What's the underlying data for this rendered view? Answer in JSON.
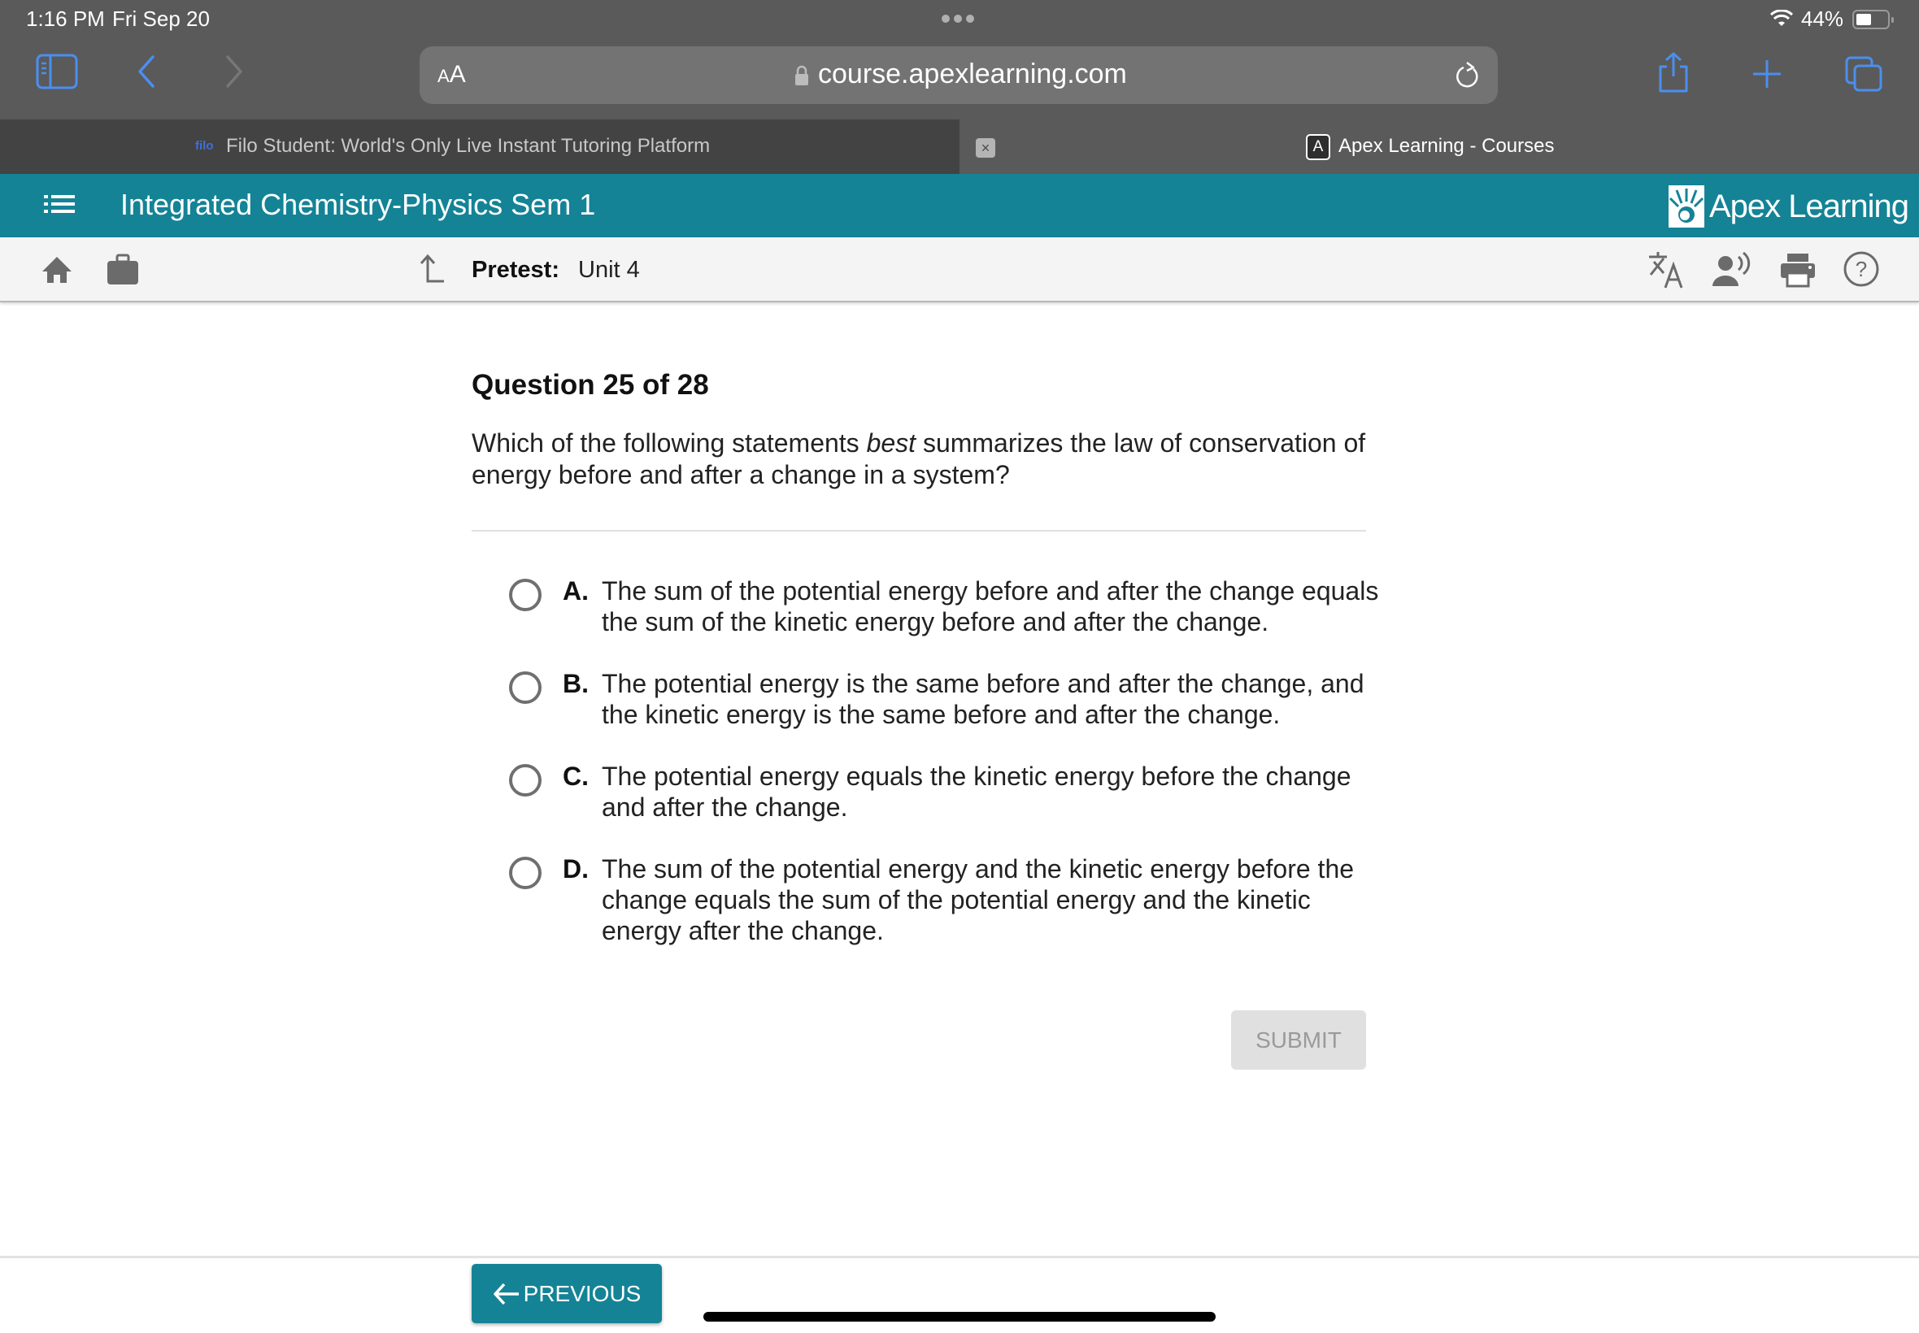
{
  "status_bar": {
    "time": "1:16 PM",
    "date": "Fri Sep 20",
    "battery_percent": "44%",
    "battery_level": 0.44
  },
  "browser": {
    "text_size_label_small": "A",
    "text_size_label_large": "A",
    "url": "course.apexlearning.com",
    "accent_color": "#4a8ff0",
    "tabs": [
      {
        "title": "Filo Student: World's Only Live Instant Tutoring Platform",
        "favicon": "filo",
        "active": false
      },
      {
        "title": "Apex Learning - Courses",
        "favicon": "A",
        "active": true
      }
    ],
    "close_tab_label": "×"
  },
  "app": {
    "course_title": "Integrated Chemistry-Physics Sem 1",
    "brand_name": "Apex Learning",
    "brand_color": "#148396",
    "breadcrumb": {
      "label": "Pretest:",
      "value": "Unit 4"
    }
  },
  "question": {
    "title": "Question 25 of 28",
    "text_before": "Which of the following statements ",
    "text_emphasis": "best",
    "text_after": " summarizes the law of conservation of energy before and after a change in a system?",
    "options": [
      {
        "letter": "A.",
        "text": "The sum of the potential energy before and after the change equals the sum of the kinetic energy before and after the change.",
        "selected": false
      },
      {
        "letter": "B.",
        "text": "The potential energy is the same before and after the change, and the kinetic energy is the same before and after the change.",
        "selected": false
      },
      {
        "letter": "C.",
        "text": "The potential energy equals the kinetic energy before the change and after the change.",
        "selected": false
      },
      {
        "letter": "D.",
        "text": "The sum of the potential energy and the kinetic energy before the change equals the sum of the potential energy and the kinetic energy after the change.",
        "selected": false
      }
    ],
    "submit_label": "SUBMIT"
  },
  "footer": {
    "previous_label": "PREVIOUS"
  }
}
